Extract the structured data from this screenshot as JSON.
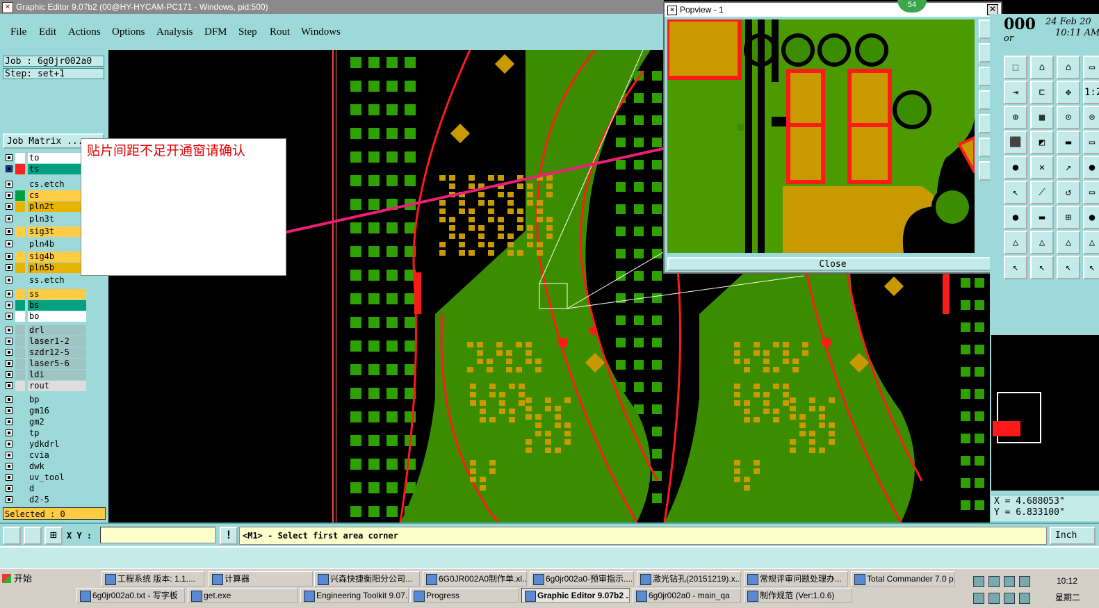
{
  "window": {
    "title": "Graphic Editor 9.07b2 (00@HY-HYCAM-PC171 - Windows, pid:500)"
  },
  "menu": [
    {
      "label": "File"
    },
    {
      "label": "Edit"
    },
    {
      "label": "Actions"
    },
    {
      "label": "Options"
    },
    {
      "label": "Analysis"
    },
    {
      "label": "DFM"
    },
    {
      "label": "Step"
    },
    {
      "label": "Rout"
    },
    {
      "label": "Windows"
    }
  ],
  "job": {
    "job_text": "Job : 6g0jr002a0",
    "step_text": "Step: set+1",
    "matrix_label": "Job Matrix ..."
  },
  "layers": [
    {
      "name": "to",
      "color": "#ffffff",
      "bg": "#ffffff"
    },
    {
      "name": "ts",
      "color": "#ff2020",
      "bg": "#00a080",
      "active": true
    },
    {
      "name": "cs.etch",
      "color": "",
      "bg": "#9ed9d9"
    },
    {
      "name": "cs",
      "color": "#00a040",
      "bg": "#ffcc44"
    },
    {
      "name": "pln2t",
      "color": "",
      "bg": "#e8b400"
    },
    {
      "name": "pln3t",
      "color": "",
      "bg": "#9ed9d9"
    },
    {
      "name": "sig3t",
      "color": "",
      "bg": "#ffcc44"
    },
    {
      "name": "pln4b",
      "color": "",
      "bg": "#9ed9d9"
    },
    {
      "name": "sig4b",
      "color": "",
      "bg": "#ffcc44"
    },
    {
      "name": "pln5b",
      "color": "",
      "bg": "#e8b400"
    },
    {
      "name": "ss.etch",
      "color": "",
      "bg": "#9ed9d9"
    },
    {
      "name": "ss",
      "color": "",
      "bg": "#ffcc44"
    },
    {
      "name": "bs",
      "color": "",
      "bg": "#00a080"
    },
    {
      "name": "bo",
      "color": "",
      "bg": "#ffffff"
    },
    {
      "name": "drl",
      "color": "",
      "bg": "#9ec4c4"
    },
    {
      "name": "laser1-2",
      "color": "",
      "bg": "#9ec4c4"
    },
    {
      "name": "szdr12-5",
      "color": "",
      "bg": "#9ec4c4"
    },
    {
      "name": "laser5-6",
      "color": "",
      "bg": "#9ec4c4"
    },
    {
      "name": "ldi",
      "color": "",
      "bg": "#9ec4c4"
    },
    {
      "name": "rout",
      "color": "",
      "bg": "#dddddd"
    },
    {
      "name": "bp",
      "color": "",
      "bg": "#9ed9d9"
    },
    {
      "name": "gm16",
      "color": "",
      "bg": "#9ed9d9"
    },
    {
      "name": "gm2",
      "color": "",
      "bg": "#9ed9d9"
    },
    {
      "name": "tp",
      "color": "",
      "bg": "#9ed9d9"
    },
    {
      "name": "ydkdrl",
      "color": "",
      "bg": "#9ed9d9"
    },
    {
      "name": "cvia",
      "color": "",
      "bg": "#9ed9d9"
    },
    {
      "name": "dwk",
      "color": "",
      "bg": "#9ed9d9"
    },
    {
      "name": "uv_tool",
      "color": "",
      "bg": "#9ed9d9"
    },
    {
      "name": "d",
      "color": "",
      "bg": "#9ed9d9"
    },
    {
      "name": "d2-5",
      "color": "",
      "bg": "#9ed9d9"
    }
  ],
  "selected_text": "Selected : 0",
  "annotation": {
    "text": "贴片间距不足开通窗请确认"
  },
  "popview": {
    "title": "Popview - 1",
    "close_label": "Close",
    "close_x": "✕"
  },
  "clock": {
    "line1": "000",
    "date": "24 Feb 20",
    "time": "10:11 AM",
    "line3": "or"
  },
  "coords": {
    "x": "X = 4.688053\"",
    "y": "Y = 6.833100\""
  },
  "command": {
    "xy_label": "X Y :",
    "xy_value": "",
    "prompt": "<M1> - Select first area corner",
    "units": "Inch"
  },
  "badge": "54",
  "taskbar": {
    "start": "开始",
    "row1": [
      {
        "label": "工程系统 版本: 1.1...."
      },
      {
        "label": "计算器"
      },
      {
        "label": "兴森快捷衡阳分公司..."
      },
      {
        "label": "6G0JR002A0制作单.xl..."
      },
      {
        "label": "6g0jr002a0-预审指示...."
      },
      {
        "label": "激光钻孔(20151219).x..."
      },
      {
        "label": "常规评审问题处理办..."
      },
      {
        "label": "Total Commander 7.0 p..."
      }
    ],
    "row2": [
      {
        "label": "6g0jr002a0.txt - 写字板"
      },
      {
        "label": "get.exe"
      },
      {
        "label": "Engineering Toolkit 9.07..."
      },
      {
        "label": "Progress"
      },
      {
        "label": "Graphic Editor 9.07b2 ...",
        "active": true
      },
      {
        "label": "6g0jr002a0 - main_qa"
      },
      {
        "label": "制作规范 (Ver:1.0.6)"
      }
    ],
    "time": "10:12",
    "day": "星期二"
  },
  "colors": {
    "panel": "#9ed9d9",
    "trace_red": "#ff1a1a",
    "board_green": "#4a9a00",
    "pad_gold": "#c89a00",
    "arrow": "#ee1e78"
  }
}
